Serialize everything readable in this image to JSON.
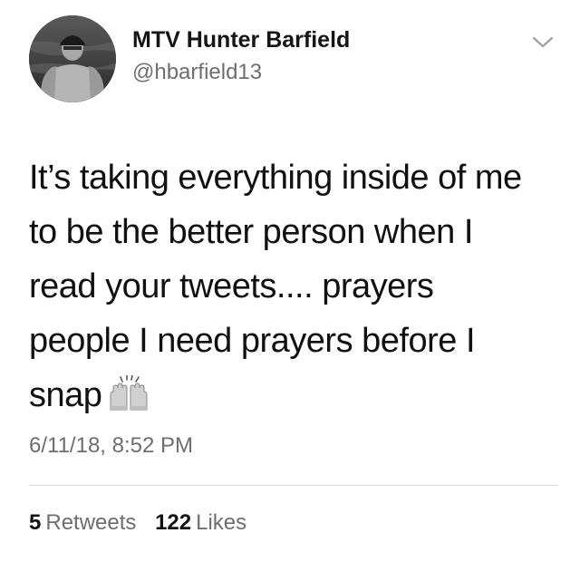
{
  "author": {
    "display_name": "MTV Hunter Barfield",
    "handle": "@hbarfield13"
  },
  "tweet": {
    "lines": [
      "It’s taking everything inside of me",
      "to be the better person when I",
      "read your tweets.... prayers",
      "people I need prayers before I",
      "snap"
    ],
    "emoji": "raising-hands-icon",
    "timestamp": "6/11/18, 8:52 PM"
  },
  "stats": {
    "retweets_count": "5",
    "retweets_label": "Retweets",
    "likes_count": "122",
    "likes_label": "Likes"
  },
  "icons": {
    "menu": "chevron-down-icon"
  }
}
